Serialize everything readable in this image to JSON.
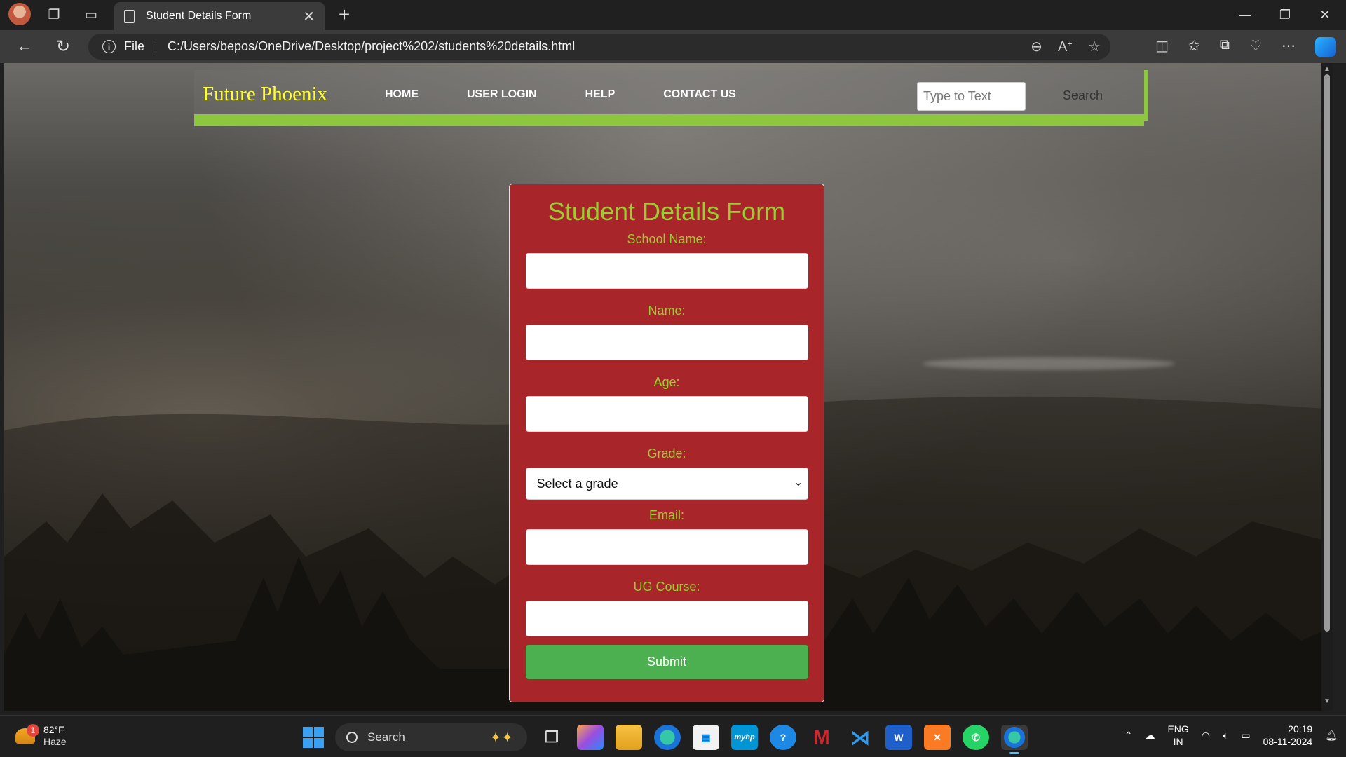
{
  "browser": {
    "tab_title": "Student Details Form",
    "address_prefix": "File",
    "url": "C:/Users/bepos/OneDrive/Desktop/project%202/students%20details.html"
  },
  "site": {
    "brand": "Future Phoenix",
    "nav": [
      "HOME",
      "USER LOGIN",
      "HELP",
      "CONTACT US"
    ],
    "search_placeholder": "Type to Text",
    "search_label": "Search",
    "accent_color": "#8dc63f",
    "brand_color": "#ffff33"
  },
  "form": {
    "title": "Student Details Form",
    "fields": {
      "school": "School Name:",
      "name": "Name:",
      "age": "Age:",
      "grade": "Grade:",
      "email": "Email:",
      "course": "UG Course:"
    },
    "grade_selected": "Select a grade",
    "submit_label": "Submit",
    "card_color": "#a8262a",
    "label_color": "#9acd32",
    "button_color": "#4caf50"
  },
  "taskbar": {
    "weather_temp": "82°F",
    "weather_cond": "Haze",
    "weather_badge": "1",
    "search_label": "Search",
    "lang_top": "ENG",
    "lang_bottom": "IN",
    "time": "20:19",
    "date": "08-11-2024",
    "pinned_apps": [
      "task-view-icon",
      "copilot-icon",
      "file-explorer-icon",
      "edge-icon",
      "microsoft-store-icon",
      "myhp-icon",
      "get-help-icon",
      "mcafee-icon",
      "vscode-icon",
      "word-icon",
      "xampp-icon",
      "whatsapp-icon",
      "edge-dev-icon"
    ]
  }
}
